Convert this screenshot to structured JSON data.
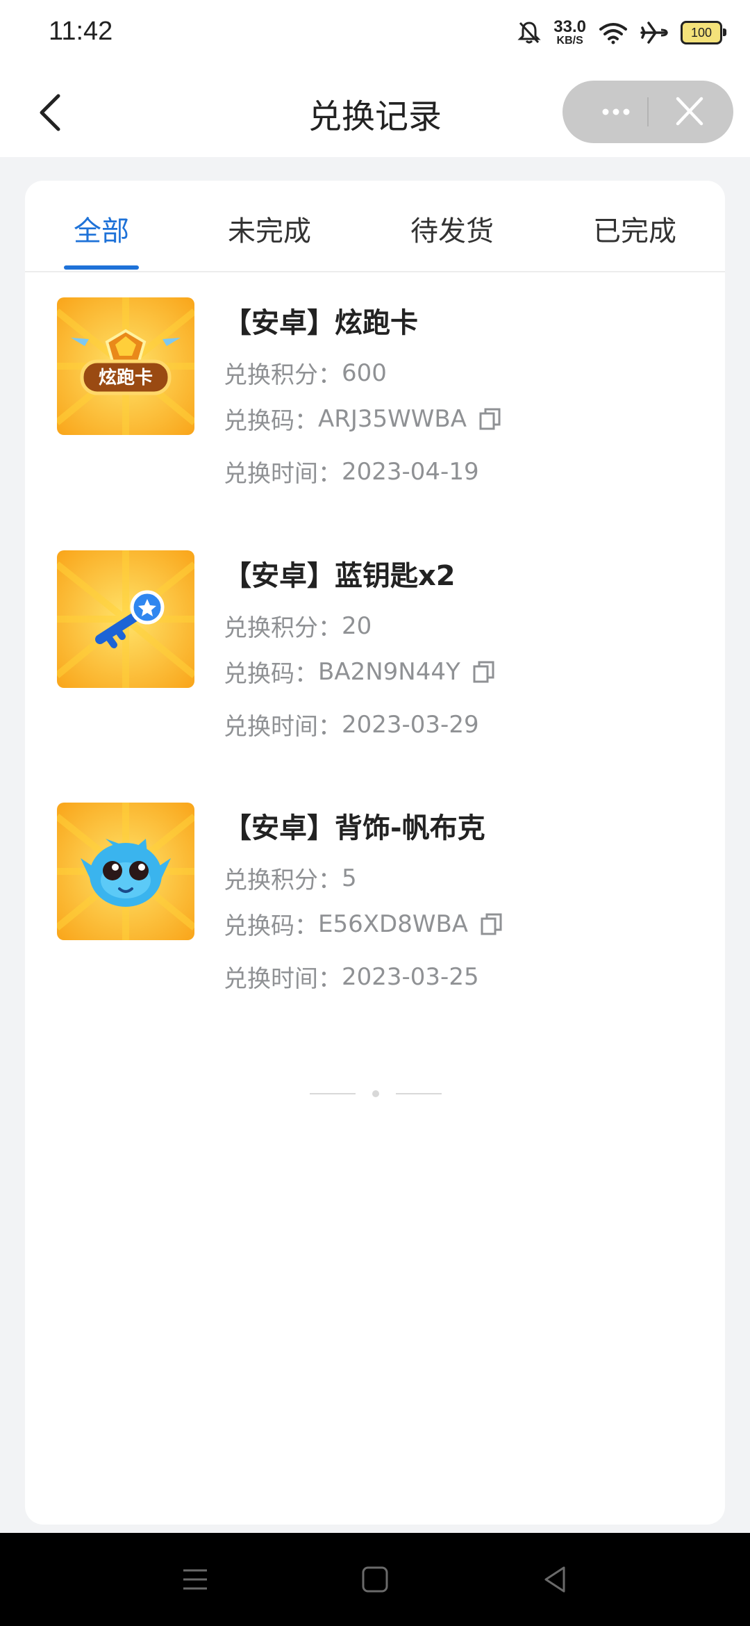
{
  "status_bar": {
    "time": "11:42",
    "net_speed_value": "33.0",
    "net_speed_unit": "KB/S",
    "battery": "100",
    "icons": [
      "bell-off-icon",
      "wifi-icon",
      "airplane-icon",
      "battery-icon"
    ]
  },
  "header": {
    "title": "兑换记录",
    "back_icon": "chevron-left-icon",
    "more_icon": "more-dots-icon",
    "close_icon": "close-icon"
  },
  "tabs": [
    {
      "label": "全部",
      "active": true
    },
    {
      "label": "未完成",
      "active": false
    },
    {
      "label": "待发货",
      "active": false
    },
    {
      "label": "已完成",
      "active": false
    }
  ],
  "colors": {
    "accent": "#1e72d8",
    "thumb_bg": "#fbb620",
    "text_secondary": "#8f9194"
  },
  "records": [
    {
      "name": "【安卓】炫跑卡",
      "points_label": "兑换积分：",
      "points": "600",
      "code_label": "兑换码：",
      "code": "ARJ35WWBA",
      "time_label": "兑换时间：",
      "time": "2023-04-19",
      "badge_text": "炫跑卡",
      "thumb_icon": "run-card-badge-icon"
    },
    {
      "name": "【安卓】蓝钥匙x2",
      "points_label": "兑换积分：",
      "points": "20",
      "code_label": "兑换码：",
      "code": "BA2N9N44Y",
      "time_label": "兑换时间：",
      "time": "2023-03-29",
      "thumb_icon": "blue-key-icon"
    },
    {
      "name": "【安卓】背饰-帆布克",
      "points_label": "兑换积分：",
      "points": "5",
      "code_label": "兑换码：",
      "code": "E56XD8WBA",
      "time_label": "兑换时间：",
      "time": "2023-03-25",
      "thumb_icon": "blue-creature-icon"
    }
  ],
  "nav_bar": {
    "icons": [
      "menu-icon",
      "home-square-icon",
      "back-triangle-icon"
    ]
  }
}
